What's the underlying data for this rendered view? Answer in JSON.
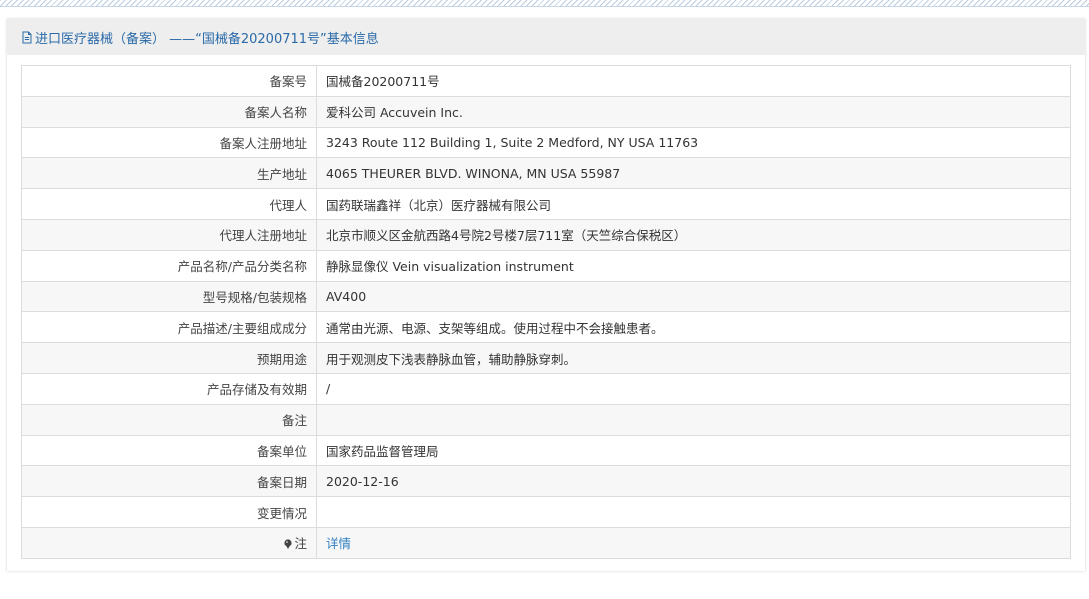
{
  "header": {
    "title": "进口医疗器械（备案） ——“国械备20200711号”基本信息"
  },
  "rows": [
    {
      "label": "备案号",
      "value": "国械备20200711号"
    },
    {
      "label": "备案人名称",
      "value": "爱科公司 Accuvein Inc."
    },
    {
      "label": "备案人注册地址",
      "value": "3243 Route 112 Building 1, Suite 2 Medford, NY USA 11763"
    },
    {
      "label": "生产地址",
      "value": "4065 THEURER BLVD. WINONA, MN USA 55987"
    },
    {
      "label": "代理人",
      "value": "国药联瑞鑫祥（北京）医疗器械有限公司"
    },
    {
      "label": "代理人注册地址",
      "value": "北京市顺义区金航西路4号院2号楼7层711室（天竺综合保税区）"
    },
    {
      "label": "产品名称/产品分类名称",
      "value": "静脉显像仪 Vein visualization instrument"
    },
    {
      "label": "型号规格/包装规格",
      "value": "AV400"
    },
    {
      "label": "产品描述/主要组成成分",
      "value": "通常由光源、电源、支架等组成。使用过程中不会接触患者。"
    },
    {
      "label": "预期用途",
      "value": "用于观测皮下浅表静脉血管，辅助静脉穿刺。"
    },
    {
      "label": "产品存储及有效期",
      "value": "/"
    },
    {
      "label": "备注",
      "value": ""
    },
    {
      "label": "备案单位",
      "value": "国家药品监督管理局"
    },
    {
      "label": "备案日期",
      "value": "2020-12-16"
    },
    {
      "label": "变更情况",
      "value": ""
    }
  ],
  "note_row": {
    "label": "注",
    "link": "详情",
    "icon": "pin-icon"
  },
  "colors": {
    "header_text": "#2a6aa8",
    "link": "#2f7fc1",
    "alt_row": "#f7f7f7",
    "border": "#dcdcdc"
  }
}
